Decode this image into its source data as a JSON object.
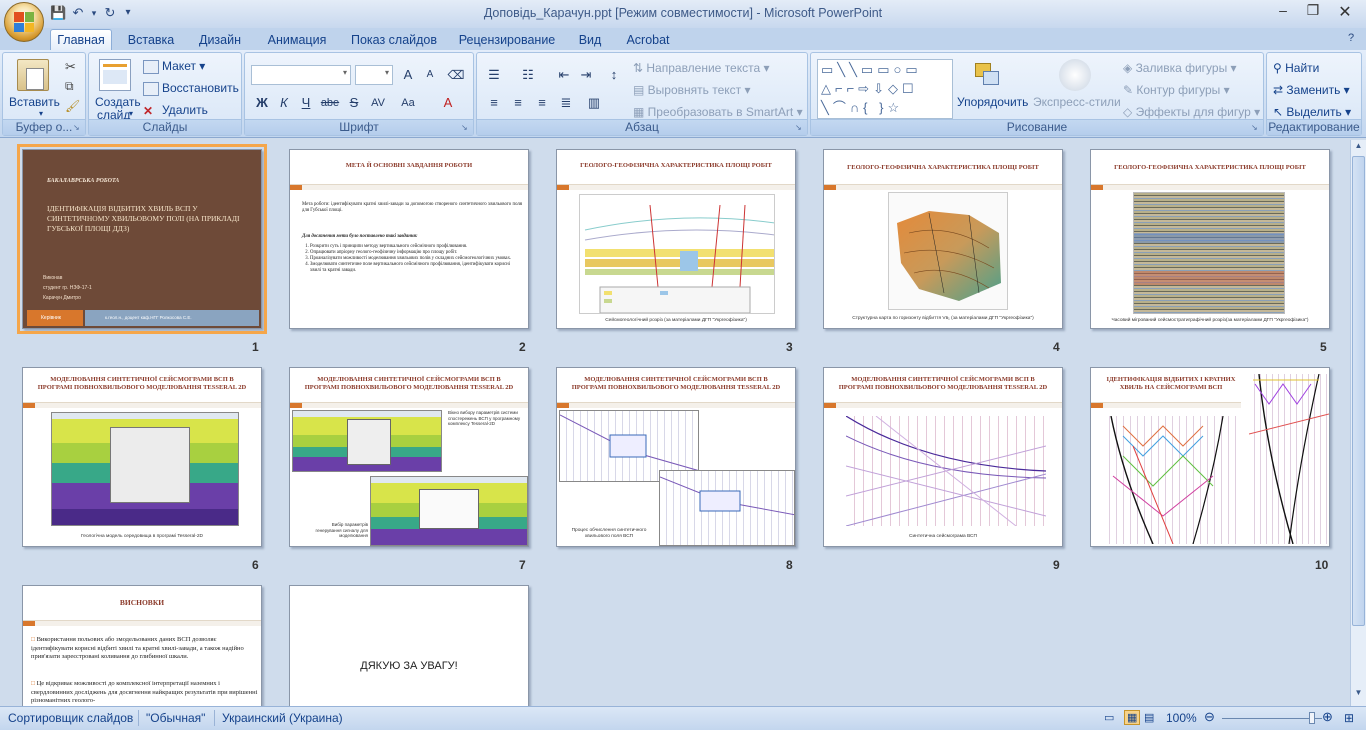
{
  "window": {
    "title": "Доповідь_Карачун.ppt [Режим совместимости] - Microsoft PowerPoint"
  },
  "qat": {
    "save_icon": "save-icon",
    "undo_icon": "undo-icon",
    "redo_icon": "redo-icon",
    "more": "▾"
  },
  "tabs": [
    "Главная",
    "Вставка",
    "Дизайн",
    "Анимация",
    "Показ слайдов",
    "Рецензирование",
    "Вид",
    "Acrobat"
  ],
  "ribbon": {
    "clipboard": {
      "label": "Буфер о...",
      "paste": "Вставить"
    },
    "slides": {
      "label": "Слайды",
      "new": "Создать",
      "new2": "слайд",
      "layout": "Макет",
      "reset": "Восстановить",
      "delete": "Удалить"
    },
    "font": {
      "label": "Шрифт",
      "bold": "Ж",
      "italic": "К",
      "underline": "Ч",
      "strike": "abe",
      "shadow": "S",
      "spacing": "AV",
      "case": "Aa",
      "color": "A",
      "grow": "A",
      "shrink": "A"
    },
    "paragraph": {
      "label": "Абзац",
      "direction": "Направление текста",
      "align": "Выровнять текст",
      "smartart": "Преобразовать в SmartArt"
    },
    "drawing": {
      "label": "Рисование",
      "arrange": "Упорядочить",
      "styles": "Экспресс-стили",
      "fill": "Заливка фигуры",
      "outline": "Контур фигуры",
      "effects": "Эффекты для фигур"
    },
    "editing": {
      "label": "Редактирование",
      "find": "Найти",
      "replace": "Заменить",
      "select": "Выделить"
    }
  },
  "slides": [
    {
      "n": "1",
      "kicker": "БАКАЛАВРСЬКА РОБОТА",
      "title": "ІДЕНТИФІКАЦІЯ ВІДБИТИХ ХВИЛЬ ВСП У СИНТЕТИЧНОМУ ХВИЛЬОВОМУ ПОЛІ (НА ПРИКЛАДІ ГУБСЬКОЇ ПЛОЩІ ДДЗ)",
      "by1": "Виконав",
      "by2": "студент гр. НЗФ-17-1",
      "by3": "Карачун Дмитро",
      "left": "Керівник",
      "right": "к.геол.н., доцент каф.НГГ Ролкосова С.Е."
    },
    {
      "n": "2",
      "title": "МЕТА Й ОСНОВНІ ЗАВДАННЯ РОБОТИ",
      "p1": "Мета роботи: ідентифікувати кратні хвилі-завади за допомогою створеного синтетичного хвильового поля для Губської площі.",
      "p2": "Для досягнення мети було поставлено такі завдання:",
      "items": [
        "Розкрити суть і принципи методу вертикального сейсмічного профілювання.",
        "Опрацювати апріорну геолого-геофізичну інформацію про площу робіт.",
        "Проаналізувати можливості моделювання хвильових полів у складних сейсмогеологічних умовах.",
        "Змоделювати синтетичне поле вертикального сейсмічного профілювання, ідентифікувати корисні хвилі та кратні завади."
      ]
    },
    {
      "n": "3",
      "title": "ГЕОЛОГО-ГЕОФІЗИЧНА ХАРАКТЕРИСТИКА ПЛОЩІ РОБІТ",
      "cap": "Сейсмогеологічний розріз  (за матеріалами ДГП \"Укргеофізика\")"
    },
    {
      "n": "4",
      "title": "ГЕОЛОГО-ГЕОФІЗИЧНА ХАРАКТЕРИСТИКА ПЛОЩІ РОБІТ",
      "cap": "Структурна карта по горизонту  відбиття  Vв₁ (за матеріалами ДГП \"Укргеофізика\")"
    },
    {
      "n": "5",
      "title": "ГЕОЛОГО-ГЕОФІЗИЧНА ХАРАКТЕРИСТИКА ПЛОЩІ РОБІТ",
      "cap": "Часовий мігрований сейсмостратиграфічний розріз(за  матеріалами ДГП \"Укргеофізика\")"
    },
    {
      "n": "6",
      "title": "МОДЕЛЮВАННЯ СИНТЕТИЧНОЇ СЕЙСМОГРАМИ ВСП В ПРОГРАМІ ПОВНОХВИЛЬОВОГО МОДЕЛЮВАННЯ TESSERAL 2D",
      "cap": "Геологічна модель середовища  в програмі Tesseral-2D"
    },
    {
      "n": "7",
      "title": "МОДЕЛЮВАННЯ СИНТЕТИЧНОЇ СЕЙСМОГРАМИ ВСП В ПРОГРАМІ ПОВНОХВИЛЬОВОГО МОДЕЛЮВАННЯ TESSERAL 2D",
      "cap1": "Вікно вибору  параметрів системи спостережень  ВСП у програмному комплексу Tesseral-2D",
      "cap2": "Вибір параметрів генерування сигналу для моделювання"
    },
    {
      "n": "8",
      "title": "МОДЕЛЮВАННЯ СИНТЕТИЧНОЇ СЕЙСМОГРАМИ ВСП В ПРОГРАМІ ПОВНОХВИЛЬОВОГО МОДЕЛЮВАННЯ TESSERAL 2D",
      "cap": "Процес обчислення  синтетичного хвильового  поля  ВСП"
    },
    {
      "n": "9",
      "title": "МОДЕЛЮВАННЯ СИНТЕТИЧНОЇ СЕЙСМОГРАМИ ВСП В ПРОГРАМІ ПОВНОХВИЛЬОВОГО МОДЕЛЮВАННЯ TESSERAL 2D",
      "cap": "Синтетична  сейсмограма ВСП"
    },
    {
      "n": "10",
      "title": "ІДЕНТИФІКАЦІЯ ВІДБИТИХ І КРАТНИХ ХВИЛЬ НА СЕЙСМОГРАМІ ВСП"
    },
    {
      "n": "11",
      "title": "ВИСНОВКИ",
      "b1": "Використання польових або змодельованих даних ВСП дозволяє ідентифікувати корисні відбиті хвилі та кратні хвилі-завади, а також надійно прив'язати зареєстровані коливання до глибинної шкали.",
      "b2": "Це відкриває можливості до комплексної інтерпретації наземних і свердловинних досліджень для досягнення найкращих результатів при вирішенні різноманітних геолого-"
    },
    {
      "n": "12",
      "text": "ДЯКУЮ ЗА УВАГУ!"
    }
  ],
  "status": {
    "view": "Сортировщик слайдов",
    "theme": "\"Обычная\"",
    "lang": "Украинский (Украина)",
    "zoom": "100%"
  }
}
